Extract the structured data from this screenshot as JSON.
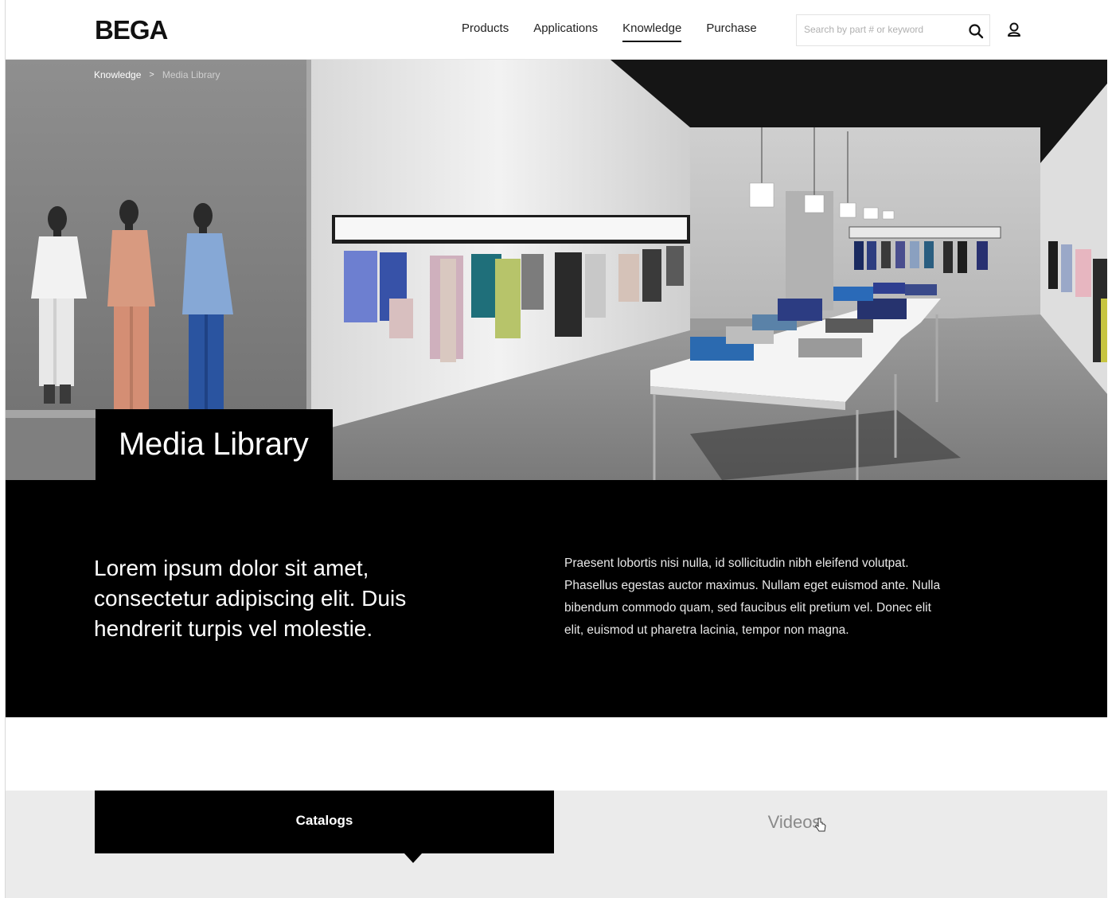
{
  "header": {
    "logo": "BEGA",
    "nav": [
      "Products",
      "Applications",
      "Knowledge",
      "Purchase"
    ],
    "active_nav": "Knowledge",
    "search": {
      "placeholder": "Search by part # or keyword"
    }
  },
  "breadcrumb": {
    "parent": "Knowledge",
    "separator": ">",
    "current": "Media Library"
  },
  "hero": {
    "title": "Media Library"
  },
  "intro": {
    "lead": "Lorem ipsum dolor sit amet, consectetur adipiscing elit. Duis hendrerit turpis vel molestie.",
    "body": "Praesent lobortis nisi nulla, id sollicitudin nibh eleifend volutpat. Phasellus egestas auctor maximus. Nullam eget euismod ante. Nulla bibendum commodo quam, sed faucibus elit pretium vel. Donec elit elit, euismod ut pharetra lacinia, tempor non magna."
  },
  "tabs": {
    "items": [
      "Catalogs",
      "Videos"
    ],
    "active": "Catalogs"
  },
  "colors": {
    "accent": "#000000",
    "tab_bg": "#ebebeb",
    "text_muted": "#8a8a8a"
  }
}
